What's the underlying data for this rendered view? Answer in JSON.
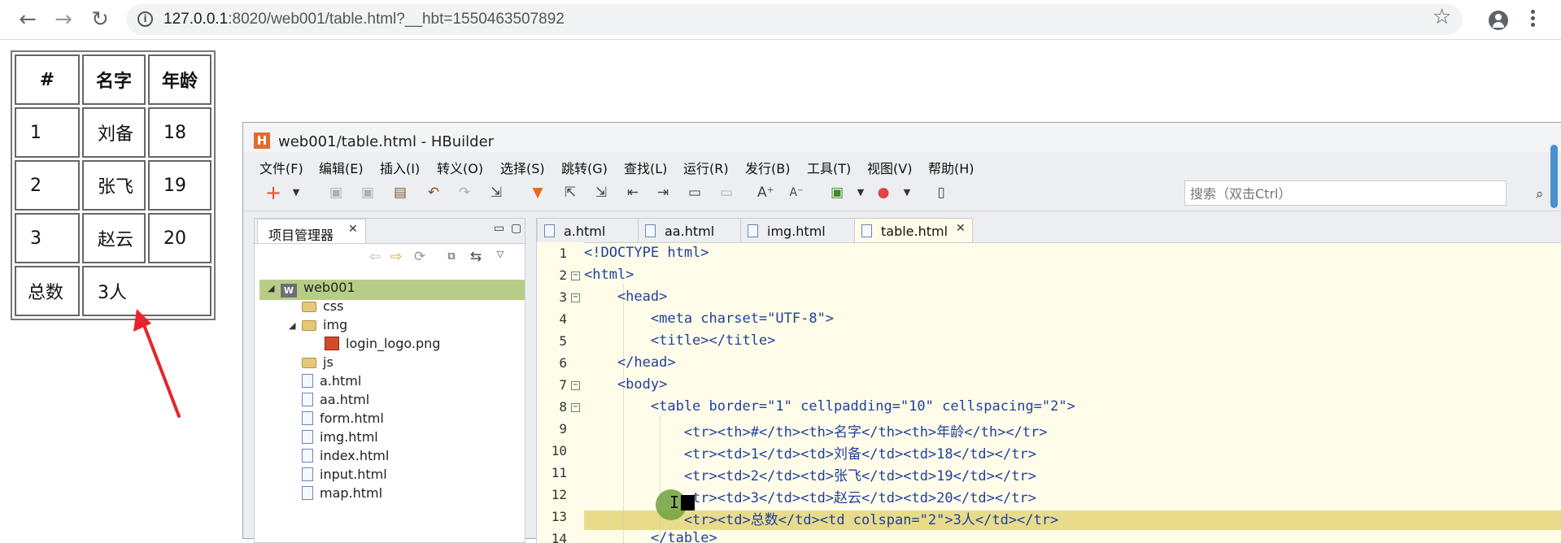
{
  "browser": {
    "url_host": "127.0.0.1",
    "url_rest": ":8020/web001/table.html?__hbt=1550463507892"
  },
  "rendered_table": {
    "headers": [
      "#",
      "名字",
      "年龄"
    ],
    "rows": [
      [
        "1",
        "刘备",
        "18"
      ],
      [
        "2",
        "张飞",
        "19"
      ],
      [
        "3",
        "赵云",
        "20"
      ]
    ],
    "total_label": "总数",
    "total_value": "3人"
  },
  "hbuilder": {
    "title": "web001/table.html  -  HBuilder",
    "menu": [
      "文件(F)",
      "编辑(E)",
      "插入(I)",
      "转义(O)",
      "选择(S)",
      "跳转(G)",
      "查找(L)",
      "运行(R)",
      "发行(B)",
      "工具(T)",
      "视图(V)",
      "帮助(H)"
    ],
    "search_placeholder": "搜索（双击Ctrl）",
    "project_panel": {
      "tab_label": "项目管理器",
      "tree": [
        {
          "label": "web001",
          "type": "project"
        },
        {
          "label": "css",
          "type": "folder"
        },
        {
          "label": "img",
          "type": "folder"
        },
        {
          "label": "login_logo.png",
          "type": "png"
        },
        {
          "label": "js",
          "type": "folder"
        },
        {
          "label": "a.html",
          "type": "file"
        },
        {
          "label": "aa.html",
          "type": "file"
        },
        {
          "label": "form.html",
          "type": "file"
        },
        {
          "label": "img.html",
          "type": "file"
        },
        {
          "label": "index.html",
          "type": "file"
        },
        {
          "label": "input.html",
          "type": "file"
        },
        {
          "label": "map.html",
          "type": "file"
        }
      ]
    },
    "editor_tabs": [
      "a.html",
      "aa.html",
      "img.html",
      "table.html"
    ],
    "active_tab": "table.html",
    "code_lines": [
      "<!DOCTYPE html>",
      "<html>",
      "    <head>",
      "        <meta charset=\"UTF-8\">",
      "        <title></title>",
      "    </head>",
      "    <body>",
      "        <table border=\"1\" cellpadding=\"10\" cellspacing=\"2\">",
      "            <tr><th>#</th><th>名字</th><th>年龄</th></tr>",
      "            <tr><td>1</td><td>刘备</td><td>18</td></tr>",
      "            <tr><td>2</td><td>张飞</td><td>19</td></tr>",
      "            <tr><td>3</td><td>赵云</td><td>20</td></tr>",
      "            <tr><td>总数</td><td colspan=\"2\">3人</td></tr>",
      "        </table>"
    ]
  },
  "colors": {
    "annotation_arrow": "#e8242a",
    "editor_bg": "#fffde9",
    "current_line": "#e8dc8b",
    "tree_selection": "#b7cd87"
  }
}
